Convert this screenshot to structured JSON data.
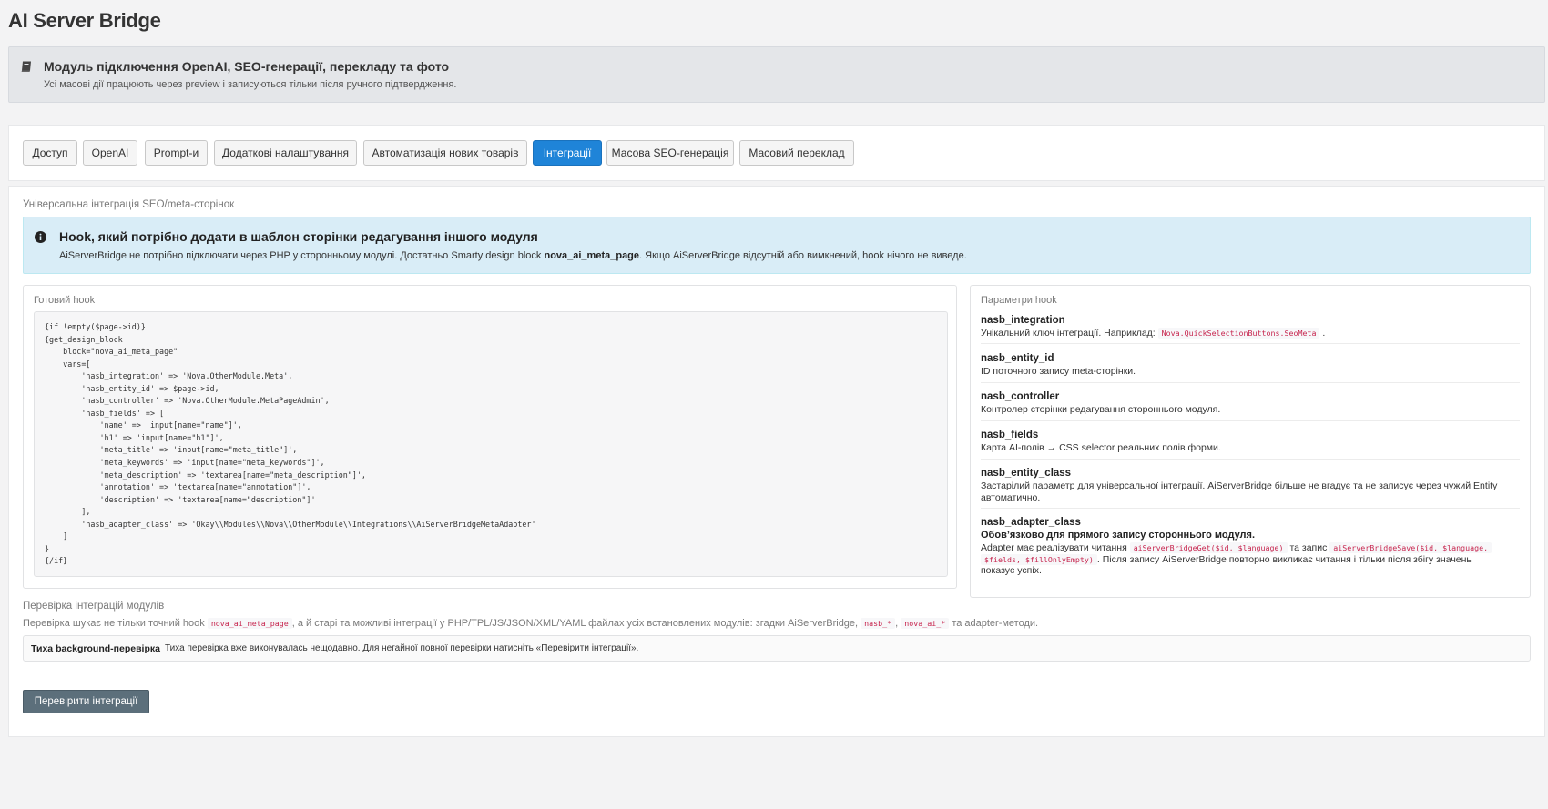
{
  "app": {
    "title": "AI Server Bridge"
  },
  "banner": {
    "icon": "book-icon",
    "title": "Модуль підключення OpenAI, SEO-генерації, перекладу та фото",
    "subtitle": "Усі масові дії працюють через preview і записуються тільки після ручного підтвердження."
  },
  "tabs": [
    {
      "label": "Доступ",
      "active": false
    },
    {
      "label": "OpenAI",
      "active": false
    },
    {
      "label": "Prompt-и",
      "active": false
    },
    {
      "label": "Додаткові налаштування",
      "active": false
    },
    {
      "label": "Автоматизація нових товарів",
      "active": false
    },
    {
      "label": "Інтеграції",
      "active": true
    },
    {
      "label": "Масова SEO-генерація",
      "active": false
    },
    {
      "label": "Масовий переклад",
      "active": false
    }
  ],
  "integration": {
    "section_title": "Універсальна інтеграція SEO/meta-сторінок",
    "info": {
      "icon": "info-circle-icon",
      "title": "Hook, який потрібно додати в шаблон сторінки редагування іншого модуля",
      "text_before": "AiServerBridge не потрібно підключати через PHP у сторонньому модулі. Достатньо Smarty design block ",
      "text_bold": "nova_ai_meta_page",
      "text_after": ". Якщо AiServerBridge відсутній або вимкнений, hook нічого не виведе."
    },
    "hook_panel": {
      "heading": "Готовий hook",
      "code": "{if !empty($page->id)}\n{get_design_block\n    block=\"nova_ai_meta_page\"\n    vars=[\n        'nasb_integration' => 'Nova.OtherModule.Meta',\n        'nasb_entity_id' => $page->id,\n        'nasb_controller' => 'Nova.OtherModule.MetaPageAdmin',\n        'nasb_fields' => [\n            'name' => 'input[name=\"name\"]',\n            'h1' => 'input[name=\"h1\"]',\n            'meta_title' => 'input[name=\"meta_title\"]',\n            'meta_keywords' => 'input[name=\"meta_keywords\"]',\n            'meta_description' => 'textarea[name=\"meta_description\"]',\n            'annotation' => 'textarea[name=\"annotation\"]',\n            'description' => 'textarea[name=\"description\"]'\n        ],\n        'nasb_adapter_class' => 'Okay\\\\Modules\\\\Nova\\\\OtherModule\\\\Integrations\\\\AiServerBridgeMetaAdapter'\n    ]\n}\n{/if}"
    },
    "params_panel": {
      "heading": "Параметри hook",
      "params": [
        {
          "name": "nasb_integration",
          "desc": "Унікальний ключ інтеграції. Наприклад:",
          "code": "Nova.QuickSelectionButtons.SeoMeta",
          "desc_after": "."
        },
        {
          "name": "nasb_entity_id",
          "desc": "ID поточного запису meta-сторінки."
        },
        {
          "name": "nasb_controller",
          "desc": "Контролер сторінки редагування стороннього модуля."
        },
        {
          "name": "nasb_fields",
          "desc": "Карта AI-полів → CSS selector реальних полів форми."
        },
        {
          "name": "nasb_entity_class",
          "desc": "Застарілий параметр для універсальної інтеграції. AiServerBridge більше не вгадує та не записує через чужий Entity автоматично."
        },
        {
          "name": "nasb_adapter_class",
          "strong": "Обов’язково для прямого запису стороннього модуля.",
          "desc_a": "Adapter має реалізувати читання",
          "code_a": "aiServerBridgeGet($id, $language)",
          "desc_b": "та запис",
          "code_b": "aiServerBridgeSave($id, $language,",
          "code_c": "$fields, $fillOnlyEmpty)",
          "desc_c": ". Після запису AiServerBridge повторно викликає читання і тільки після збігу значень",
          "desc_d": "показує успіх."
        }
      ]
    }
  },
  "module_check": {
    "section_title": "Перевірка інтеграцій модулів",
    "desc_a": "Перевірка шукає не тільки точний hook",
    "code_a": "nova_ai_meta_page",
    "desc_b": ", а й старі та можливі інтеграції у PHP/TPL/JS/JSON/XML/YAML файлах усіх встановлених модулів: згадки AiServerBridge,",
    "code_b": "nasb_*",
    "desc_sep": ",",
    "code_c": "nova_ai_*",
    "desc_c": "та adapter-методи.",
    "quiet_label": "Тиха background-перевірка",
    "quiet_text": "Тиха перевірка вже виконувалась нещодавно. Для негайної повної перевірки натисніть «Перевірити інтеграції».",
    "button_label": "Перевірити інтеграції"
  }
}
